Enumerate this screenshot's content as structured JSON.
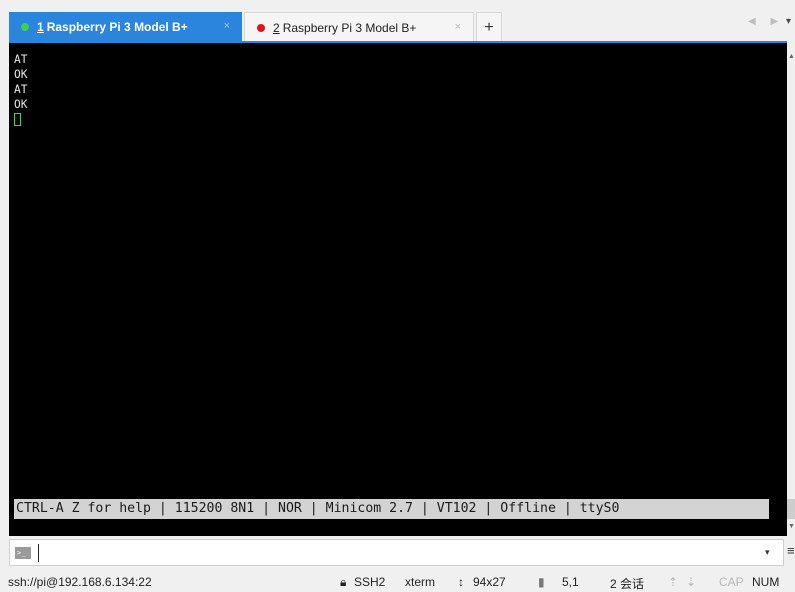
{
  "tabs": [
    {
      "number": "1",
      "title": "Raspberry Pi 3 Model B+",
      "status_color": "#3ecf4e",
      "active": true
    },
    {
      "number": "2",
      "title": "Raspberry Pi 3 Model B+",
      "status_color": "#e0151c",
      "active": false
    }
  ],
  "tab_controls": {
    "new_tab": "+",
    "close": "×",
    "nav": "◀ ▶",
    "menu": "▾"
  },
  "terminal": {
    "lines": [
      "AT",
      "OK",
      "AT",
      "OK"
    ],
    "status_line": "CTRL-A Z for help | 115200 8N1 | NOR | Minicom 2.7 | VT102 | Offline | ttyS0"
  },
  "compose": {
    "icon": "command-prompt-icon",
    "value": "",
    "dropdown": "▾",
    "menu": "≡"
  },
  "statusbar": {
    "connection": "ssh://pi@192.168.6.134:22",
    "protocol": "SSH2",
    "terminal_type": "xterm",
    "size": "94x27",
    "cursor_pos": "5,1",
    "sessions": "2 会话",
    "caps": "CAP",
    "num": "NUM"
  },
  "colors": {
    "accent": "#2b85dc",
    "terminal_bg": "#000000",
    "cursor": "#2ee82e"
  }
}
